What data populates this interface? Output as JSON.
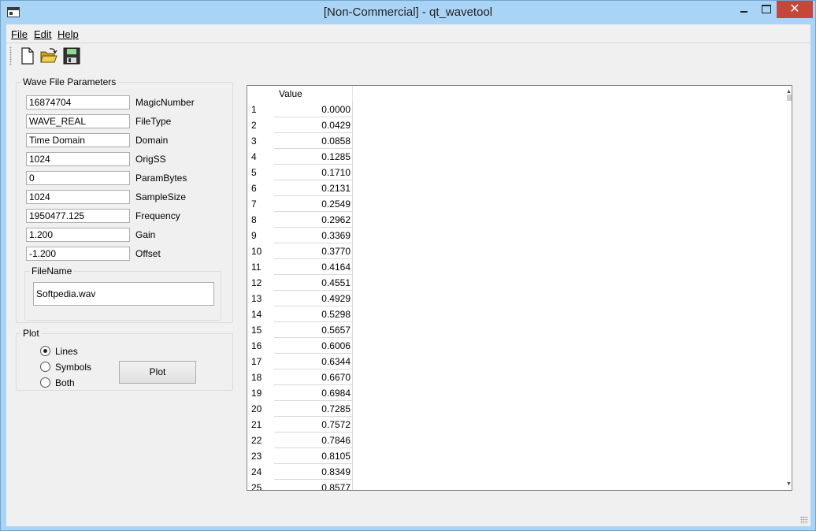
{
  "window": {
    "title": "[Non-Commercial] - qt_wavetool",
    "close_glyph": "✕"
  },
  "menu": {
    "file": "File",
    "edit": "Edit",
    "help": "Help"
  },
  "toolbar": {
    "icons": [
      "new-file-icon",
      "open-folder-icon",
      "save-disk-icon"
    ]
  },
  "params": {
    "title": "Wave File Parameters",
    "fields": [
      {
        "value": "16874704",
        "label": "MagicNumber"
      },
      {
        "value": "WAVE_REAL",
        "label": "FileType"
      },
      {
        "value": "Time Domain",
        "label": "Domain"
      },
      {
        "value": "1024",
        "label": "OrigSS"
      },
      {
        "value": "0",
        "label": "ParamBytes"
      },
      {
        "value": "1024",
        "label": "SampleSize"
      },
      {
        "value": "1950477.125",
        "label": "Frequency"
      },
      {
        "value": "1.200",
        "label": "Gain"
      },
      {
        "value": "-1.200",
        "label": "Offset"
      }
    ],
    "filename": {
      "title": "FileName",
      "value": "Softpedia.wav"
    }
  },
  "plot": {
    "title": "Plot",
    "options": [
      {
        "label": "Lines",
        "checked": true
      },
      {
        "label": "Symbols",
        "checked": false
      },
      {
        "label": "Both",
        "checked": false
      }
    ],
    "button_label": "Plot"
  },
  "table": {
    "column_header": "Value",
    "rows": [
      {
        "index": "1",
        "value": "0.0000"
      },
      {
        "index": "2",
        "value": "0.0429"
      },
      {
        "index": "3",
        "value": "0.0858"
      },
      {
        "index": "4",
        "value": "0.1285"
      },
      {
        "index": "5",
        "value": "0.1710"
      },
      {
        "index": "6",
        "value": "0.2131"
      },
      {
        "index": "7",
        "value": "0.2549"
      },
      {
        "index": "8",
        "value": "0.2962"
      },
      {
        "index": "9",
        "value": "0.3369"
      },
      {
        "index": "10",
        "value": "0.3770"
      },
      {
        "index": "11",
        "value": "0.4164"
      },
      {
        "index": "12",
        "value": "0.4551"
      },
      {
        "index": "13",
        "value": "0.4929"
      },
      {
        "index": "14",
        "value": "0.5298"
      },
      {
        "index": "15",
        "value": "0.5657"
      },
      {
        "index": "16",
        "value": "0.6006"
      },
      {
        "index": "17",
        "value": "0.6344"
      },
      {
        "index": "18",
        "value": "0.6670"
      },
      {
        "index": "19",
        "value": "0.6984"
      },
      {
        "index": "20",
        "value": "0.7285"
      },
      {
        "index": "21",
        "value": "0.7572"
      },
      {
        "index": "22",
        "value": "0.7846"
      },
      {
        "index": "23",
        "value": "0.8105"
      },
      {
        "index": "24",
        "value": "0.8349"
      },
      {
        "index": "25",
        "value": "0.8577"
      }
    ]
  }
}
